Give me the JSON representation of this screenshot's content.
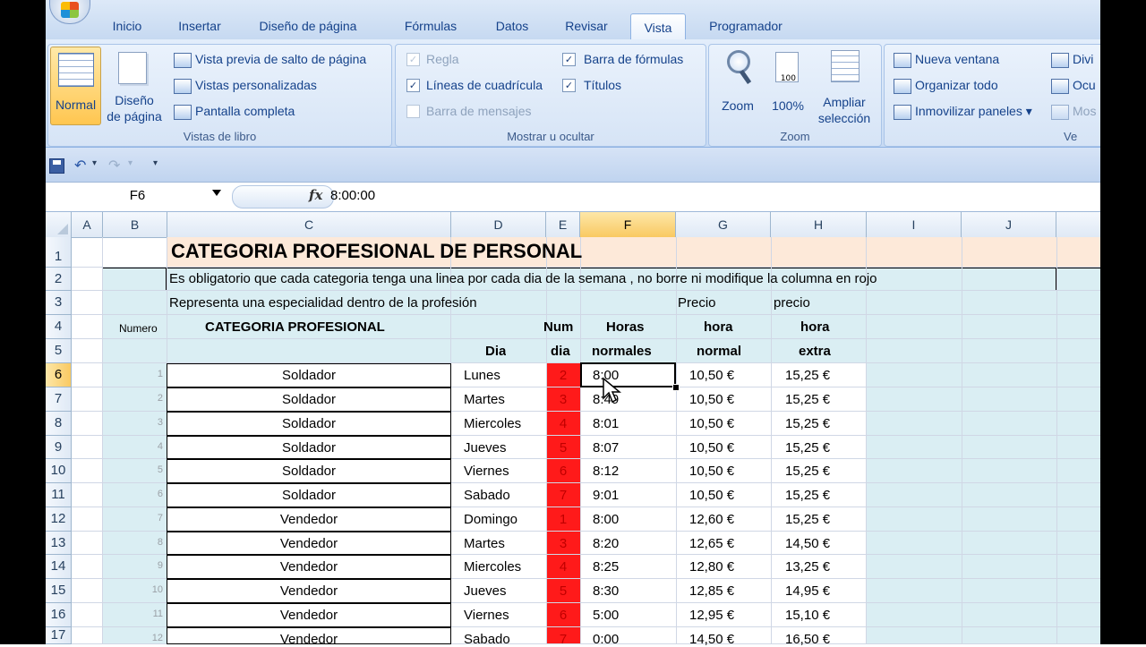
{
  "tabs": [
    "Inicio",
    "Insertar",
    "Diseño de página",
    "Fórmulas",
    "Datos",
    "Revisar",
    "Vista",
    "Programador"
  ],
  "active_tab": "Vista",
  "ribbon": {
    "vistas_libro": {
      "label": "Vistas de libro",
      "normal": "Normal",
      "diseno_1": "Diseño",
      "diseno_2": "de página",
      "salto": "Vista previa de salto de página",
      "personalizadas": "Vistas personalizadas",
      "pantalla": "Pantalla completa"
    },
    "mostrar": {
      "label": "Mostrar u ocultar",
      "regla": "Regla",
      "lineas": "Líneas de cuadrícula",
      "mensajes": "Barra de mensajes",
      "formulas": "Barra de fórmulas",
      "titulos": "Títulos",
      "check": "✓"
    },
    "zoom": {
      "label": "Zoom",
      "zoom": "Zoom",
      "cien": "100%",
      "ampliar_1": "Ampliar",
      "ampliar_2": "selección",
      "icon_100": "100"
    },
    "ventana": {
      "label": "Ve",
      "nueva": "Nueva ventana",
      "organizar": "Organizar todo",
      "inmovilizar": "Inmovilizar paneles",
      "dividir": "Divi",
      "ocultar": "Ocu",
      "mostrar": "Mos"
    }
  },
  "qat": {
    "dropdown": "▾"
  },
  "formula_bar": {
    "name_box": "F6",
    "fx": "fx",
    "formula": "8:00:00"
  },
  "columns": [
    "A",
    "B",
    "C",
    "D",
    "E",
    "F",
    "G",
    "H",
    "I",
    "J"
  ],
  "rows": [
    "1",
    "2",
    "3",
    "4",
    "5",
    "6",
    "7",
    "8",
    "9",
    "10",
    "11",
    "12",
    "13",
    "14",
    "15",
    "16",
    "17"
  ],
  "sheet": {
    "title": "CATEGORIA PROFESIONAL  DE PERSONAL",
    "note": "Es obligatorio que cada categoria tenga una linea por cada dia de la semana , no borre ni modifique la columna en rojo",
    "represent": "Representa una especialidad dentro de la profesión",
    "precio_g": "Precio",
    "precio_h": "precio",
    "numero": "Numero",
    "categoria": "CATEGORIA PROFESIONAL",
    "num": "Num",
    "horas": "Horas",
    "hora_g": "hora",
    "hora_h": "hora",
    "dia_d": "Dia",
    "dia_e": "dia",
    "normales": "normales",
    "normal": "normal",
    "extra": "extra"
  },
  "data_rows": [
    {
      "n": "1",
      "cat": "Soldador",
      "dia": "Lunes",
      "num": "2",
      "horas": "8:00",
      "precio": "10,50 €",
      "extra": "15,25 €"
    },
    {
      "n": "2",
      "cat": "Soldador",
      "dia": "Martes",
      "num": "3",
      "horas": "8:49",
      "precio": "10,50 €",
      "extra": "15,25 €"
    },
    {
      "n": "3",
      "cat": "Soldador",
      "dia": "Miercoles",
      "num": "4",
      "horas": "8:01",
      "precio": "10,50 €",
      "extra": "15,25 €"
    },
    {
      "n": "4",
      "cat": "Soldador",
      "dia": "Jueves",
      "num": "5",
      "horas": "8:07",
      "precio": "10,50 €",
      "extra": "15,25 €"
    },
    {
      "n": "5",
      "cat": "Soldador",
      "dia": "Viernes",
      "num": "6",
      "horas": "8:12",
      "precio": "10,50 €",
      "extra": "15,25 €"
    },
    {
      "n": "6",
      "cat": "Soldador",
      "dia": "Sabado",
      "num": "7",
      "horas": "9:01",
      "precio": "10,50 €",
      "extra": "15,25 €"
    },
    {
      "n": "7",
      "cat": "Vendedor",
      "dia": "Domingo",
      "num": "1",
      "horas": "8:00",
      "precio": "12,60 €",
      "extra": "15,25 €"
    },
    {
      "n": "8",
      "cat": "Vendedor",
      "dia": "Martes",
      "num": "3",
      "horas": "8:20",
      "precio": "12,65 €",
      "extra": "14,50 €"
    },
    {
      "n": "9",
      "cat": "Vendedor",
      "dia": "Miercoles",
      "num": "4",
      "horas": "8:25",
      "precio": "12,80 €",
      "extra": "13,25 €"
    },
    {
      "n": "10",
      "cat": "Vendedor",
      "dia": "Jueves",
      "num": "5",
      "horas": "8:30",
      "precio": "12,85 €",
      "extra": "14,95 €"
    },
    {
      "n": "11",
      "cat": "Vendedor",
      "dia": "Viernes",
      "num": "6",
      "horas": "5:00",
      "precio": "12,95 €",
      "extra": "15,10 €"
    },
    {
      "n": "12",
      "cat": "Vendedor",
      "dia": "Sabado",
      "num": "7",
      "horas": "0:00",
      "precio": "14,50 €",
      "extra": "16,50 €"
    }
  ],
  "colors": {
    "red_column": "#ff1a1a",
    "header_band": "#fde9d9",
    "light_band": "#daeef3"
  }
}
